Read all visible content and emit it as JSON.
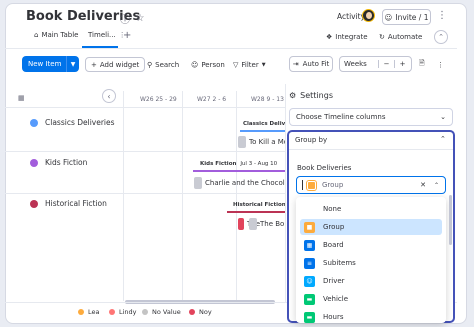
{
  "board": {
    "title": "Book Deliveries"
  },
  "header": {
    "activity_label": "Activity",
    "invite_label": "Invite / 1"
  },
  "tabs": [
    {
      "label": "Main Table"
    },
    {
      "label": "Timeli..."
    }
  ],
  "right_links": {
    "integrate": "Integrate",
    "automate": "Automate"
  },
  "toolbar": {
    "new_item": "New Item",
    "add_widget": "Add widget",
    "search": "Search",
    "person": "Person",
    "filter": "Filter",
    "auto_fit": "Auto Fit",
    "scale": "Weeks"
  },
  "weeks": [
    "W26 25 - 29",
    "W27 2 - 6",
    "W28 9 - 13"
  ],
  "groups": [
    {
      "name": "Classics Deliveries",
      "color": "#579bfc"
    },
    {
      "name": "Kids Fiction",
      "color": "#a25ddc"
    },
    {
      "name": "Historical Fiction",
      "color": "#bb3354"
    }
  ],
  "timeline_items": {
    "classics": {
      "group_label": "Classics Delivi",
      "item": "To Kill a Mo"
    },
    "kids": {
      "group_label": "Kids Fiction",
      "dates": "Jul 3 - Aug 10",
      "item": "Charlie and the Chocolate Fa"
    },
    "historical": {
      "group_label": "Historical Fiction",
      "item1": "The",
      "item2": "The Bo"
    }
  },
  "legend": [
    {
      "label": "Lea",
      "color": "#fdab3d"
    },
    {
      "label": "Lindy",
      "color": "#ff7575"
    },
    {
      "label": "No Value",
      "color": "#c4c4c4"
    },
    {
      "label": "Noy",
      "color": "#e2445c"
    }
  ],
  "settings": {
    "title": "Settings",
    "timeline_columns": "Choose Timeline columns",
    "group_by": "Group by",
    "board_label": "Book Deliveries",
    "select_value": "Group",
    "options": [
      {
        "label": "None",
        "icon": "",
        "color": ""
      },
      {
        "label": "Group",
        "icon": "group-icon",
        "color": "#fdab3d"
      },
      {
        "label": "Board",
        "icon": "board-icon",
        "color": "#0073ea"
      },
      {
        "label": "Subitems",
        "icon": "subitems-icon",
        "color": "#0073ea"
      },
      {
        "label": "Driver",
        "icon": "people-icon",
        "color": "#00a9ff"
      },
      {
        "label": "Vehicle",
        "icon": "status-icon",
        "color": "#00c875"
      },
      {
        "label": "Hours",
        "icon": "hours-icon",
        "color": "#00c875"
      }
    ],
    "selected_option": "Group"
  }
}
